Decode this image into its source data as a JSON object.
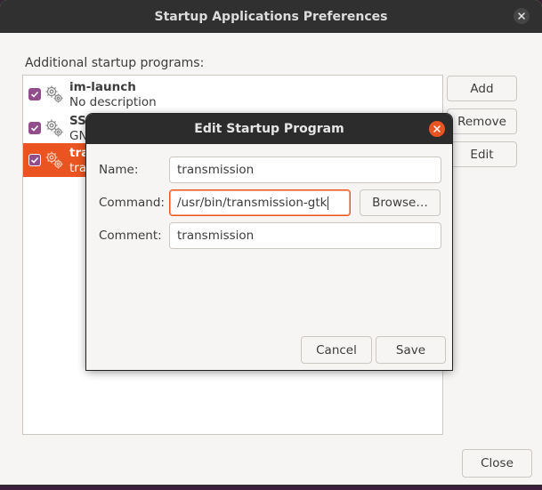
{
  "main_window": {
    "title": "Startup Applications Preferences",
    "section_label": "Additional startup programs:",
    "programs": [
      {
        "name": "im-launch",
        "description": "No description",
        "checked": true,
        "selected": false
      },
      {
        "name": "SSH",
        "description": "GNOME",
        "checked": true,
        "selected": false
      },
      {
        "name": "transmission",
        "description": "transmission",
        "checked": true,
        "selected": true
      }
    ],
    "buttons": {
      "add": "Add",
      "remove": "Remove",
      "edit": "Edit",
      "close": "Close"
    }
  },
  "dialog": {
    "title": "Edit Startup Program",
    "name_label": "Name:",
    "name_value": "transmission",
    "command_label": "Command:",
    "command_value": "/usr/bin/transmission-gtk",
    "browse_label": "Browse…",
    "comment_label": "Comment:",
    "comment_value": "transmission",
    "cancel_label": "Cancel",
    "save_label": "Save"
  },
  "colors": {
    "accent": "#e95420",
    "checkbox": "#924d8b",
    "titlebar": "#303030",
    "background": "#f6f5f4"
  },
  "icons": {
    "program_icon": "gear-icon",
    "window_close": "close-icon",
    "checkbox": "checkmark-icon"
  }
}
